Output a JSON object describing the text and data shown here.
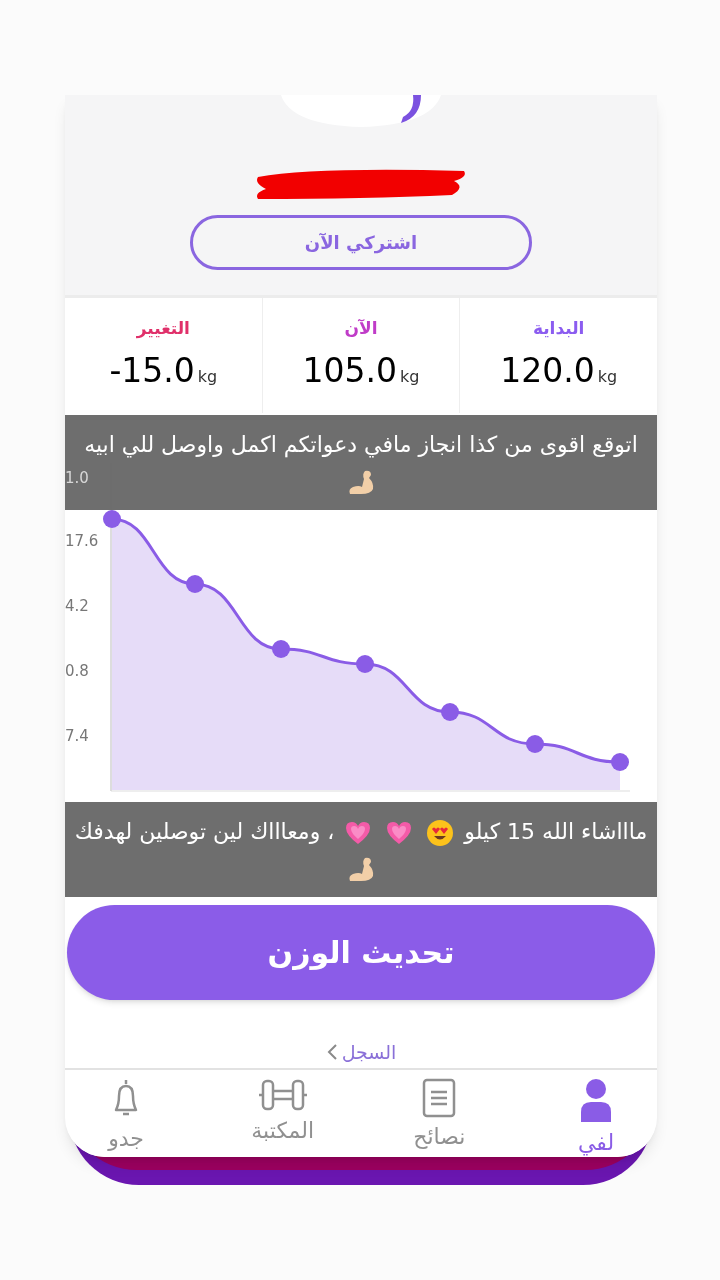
{
  "subscribe_button": "اشتركي الآن",
  "stats": [
    {
      "kind": "start",
      "label": "البداية",
      "value": "120.0",
      "unit": "kg"
    },
    {
      "kind": "now",
      "label": "الآن",
      "value": "105.0",
      "unit": "kg"
    },
    {
      "kind": "change",
      "label": "التغيير",
      "value": "-15.0",
      "unit": "kg"
    }
  ],
  "caption_top": [
    {
      "kind": "text",
      "text": "اتوقع اقوى من كذا انجاز مافي دعواتكم اكمل واوصل للي ابيه"
    },
    {
      "kind": "arm"
    }
  ],
  "chart": {
    "y_axis_labels": [
      "1.0",
      "17.6",
      "4.2",
      "0.8",
      "7.4"
    ]
  },
  "caption_bottom": [
    {
      "kind": "text",
      "text": "ماااشاء الله 15 كيلو"
    },
    {
      "kind": "smiley"
    },
    {
      "kind": "heart"
    },
    {
      "kind": "heart"
    },
    {
      "kind": "text",
      "text": "، ومعاااك لين توصلين لهدفك"
    },
    {
      "kind": "arm"
    }
  ],
  "update_button": "تحديث الوزن",
  "history_link": "السجل",
  "bottom_nav": [
    {
      "kind": "person",
      "label": "لفي",
      "selected": true
    },
    {
      "kind": "document",
      "label": "نصائح",
      "selected": false
    },
    {
      "kind": "dumbbell",
      "label": "المكتبة",
      "selected": false
    },
    {
      "kind": "bell",
      "label": "جدو",
      "selected": false
    }
  ]
}
